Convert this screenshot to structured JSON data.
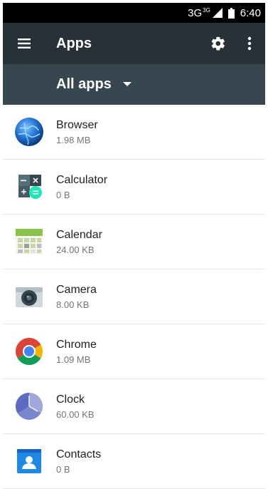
{
  "status_bar": {
    "network": "3G",
    "network_sup": "3G",
    "time": "6:40"
  },
  "toolbar": {
    "title": "Apps"
  },
  "filter": {
    "label": "All apps"
  },
  "apps": [
    {
      "name": "Browser",
      "size": "1.98 MB",
      "icon": "browser-icon"
    },
    {
      "name": "Calculator",
      "size": "0 B",
      "icon": "calculator-icon"
    },
    {
      "name": "Calendar",
      "size": "24.00 KB",
      "icon": "calendar-icon"
    },
    {
      "name": "Camera",
      "size": "8.00 KB",
      "icon": "camera-icon"
    },
    {
      "name": "Chrome",
      "size": "1.09 MB",
      "icon": "chrome-icon"
    },
    {
      "name": "Clock",
      "size": "60.00 KB",
      "icon": "clock-icon"
    },
    {
      "name": "Contacts",
      "size": "0 B",
      "icon": "contacts-icon"
    }
  ]
}
